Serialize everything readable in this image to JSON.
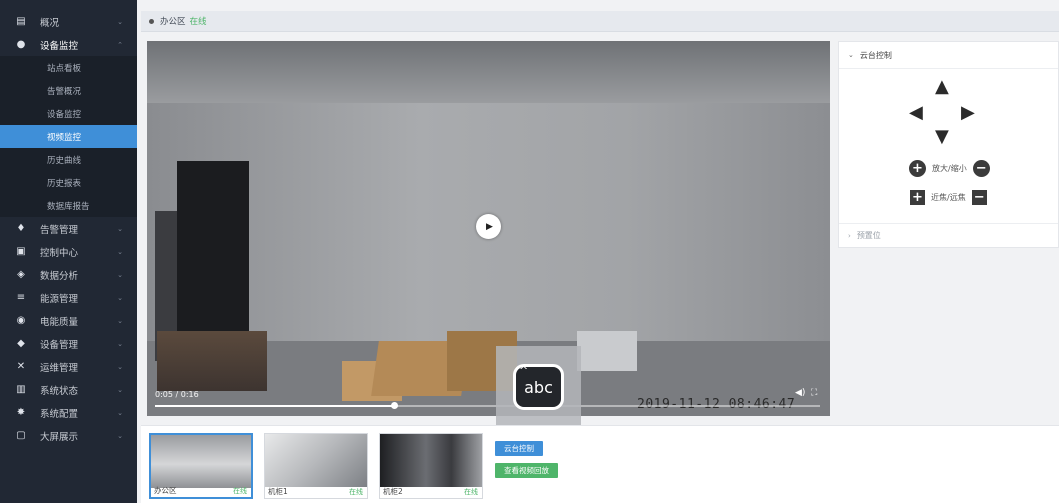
{
  "sidebar": {
    "items": [
      {
        "label": "概况",
        "icon": "dashboard-icon",
        "glyph": "▤",
        "arrow": "⌄"
      },
      {
        "label": "设备监控",
        "icon": "monitor-icon",
        "glyph": "●",
        "arrow": "⌃"
      },
      {
        "label": "告警管理",
        "icon": "bell-icon",
        "glyph": "♦",
        "arrow": "⌄"
      },
      {
        "label": "控制中心",
        "icon": "control-icon",
        "glyph": "▣",
        "arrow": "⌄"
      },
      {
        "label": "数据分析",
        "icon": "analysis-icon",
        "glyph": "◈",
        "arrow": "⌄"
      },
      {
        "label": "能源管理",
        "icon": "energy-icon",
        "glyph": "≡",
        "arrow": "⌄"
      },
      {
        "label": "电能质量",
        "icon": "power-icon",
        "glyph": "◉",
        "arrow": "⌄"
      },
      {
        "label": "设备管理",
        "icon": "device-icon",
        "glyph": "◆",
        "arrow": "⌄"
      },
      {
        "label": "运维管理",
        "icon": "wrench-icon",
        "glyph": "✕",
        "arrow": "⌄"
      },
      {
        "label": "系统状态",
        "icon": "status-icon",
        "glyph": "▥",
        "arrow": "⌄"
      },
      {
        "label": "系统配置",
        "icon": "gear-icon",
        "glyph": "✸",
        "arrow": "⌄"
      },
      {
        "label": "大屏展示",
        "icon": "screen-icon",
        "glyph": "▢",
        "arrow": "⌄"
      }
    ],
    "sub_items": [
      "站点看板",
      "告警概况",
      "设备监控",
      "视频监控",
      "历史曲线",
      "历史报表",
      "数据库报告"
    ]
  },
  "breadcrumb": {
    "location": "办公区",
    "status": "在线"
  },
  "video": {
    "time": "0:05 / 0:16",
    "timestamp": "2019-11-12 08:46:47",
    "progress": 0.36,
    "ime_label": "abc",
    "ime_caret": "^"
  },
  "ptz": {
    "title": "云台控制",
    "zoom_label": "放大/缩小",
    "focus_label": "近焦/远焦",
    "preset_title": "预置位",
    "zoom_in": "+",
    "zoom_out": "−",
    "focus_near": "+",
    "focus_far": "−"
  },
  "thumbs": [
    {
      "name": "办公区",
      "status": "在线"
    },
    {
      "name": "机柜1",
      "status": "在线"
    },
    {
      "name": "机柜2",
      "status": "在线"
    }
  ],
  "buttons": {
    "snapshot": "云台控制",
    "playback": "查看视频回放"
  },
  "colors": {
    "sidebar": "#212834",
    "active": "#3f8fd8",
    "online": "#4fb56a"
  }
}
